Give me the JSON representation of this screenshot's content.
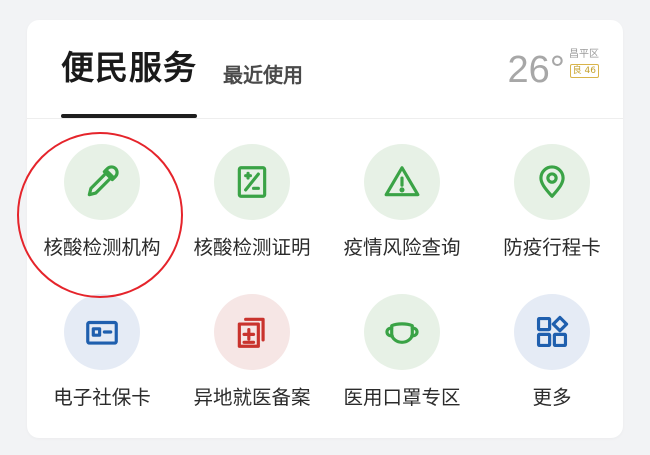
{
  "header": {
    "title": "便民服务",
    "recent_tab": "最近使用"
  },
  "weather": {
    "temperature": "26°",
    "district": "昌平区",
    "aqi": "良 46"
  },
  "services": [
    {
      "label": "核酸检测机构",
      "icon": "dropper-icon",
      "color": "#3aa346",
      "bg": "#e7f1e6"
    },
    {
      "label": "核酸检测证明",
      "icon": "certificate-icon",
      "color": "#3aa346",
      "bg": "#e7f1e6"
    },
    {
      "label": "疫情风险查询",
      "icon": "warning-icon",
      "color": "#3aa346",
      "bg": "#e7f1e6"
    },
    {
      "label": "防疫行程卡",
      "icon": "location-pin-icon",
      "color": "#3aa346",
      "bg": "#e7f1e6"
    },
    {
      "label": "电子社保卡",
      "icon": "id-card-icon",
      "color": "#1f5fae",
      "bg": "#e5ebf5"
    },
    {
      "label": "异地就医备案",
      "icon": "medical-record-icon",
      "color": "#c9332d",
      "bg": "#f6e6e5"
    },
    {
      "label": "医用口罩专区",
      "icon": "face-mask-icon",
      "color": "#3aa346",
      "bg": "#e7f1e6"
    },
    {
      "label": "更多",
      "icon": "apps-grid-icon",
      "color": "#1f5fae",
      "bg": "#e5ebf5"
    }
  ],
  "colors": {
    "highlight": "#e5242b"
  }
}
